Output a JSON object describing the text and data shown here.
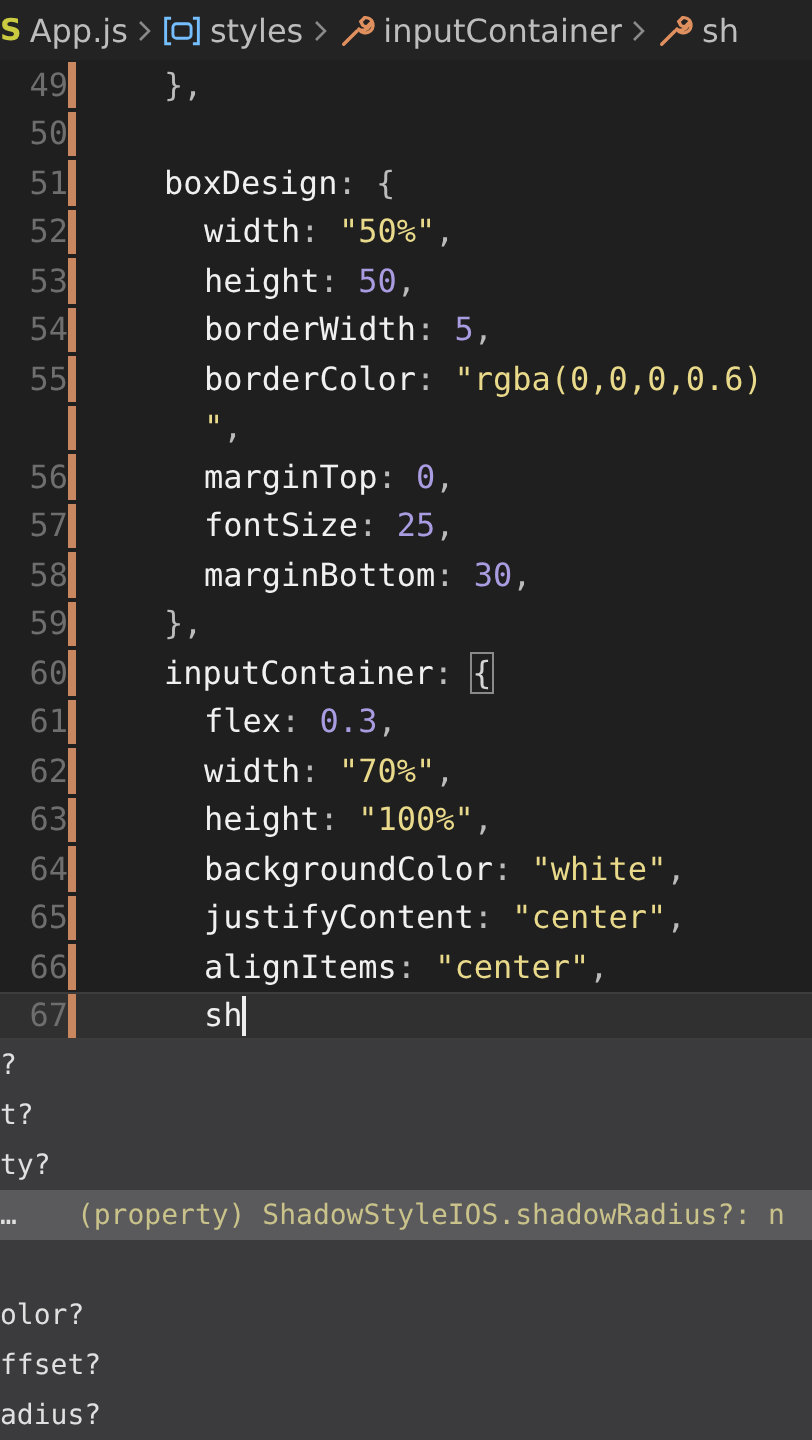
{
  "breadcrumbs": [
    {
      "kind": "file",
      "badge": "S",
      "label": "App.js"
    },
    {
      "kind": "variable",
      "label": "styles"
    },
    {
      "kind": "property",
      "label": "inputContainer"
    },
    {
      "kind": "property",
      "label": "sh"
    }
  ],
  "editor": {
    "lines": [
      {
        "number": "49",
        "tokens": [
          {
            "kind": "punct",
            "text": "},"
          }
        ],
        "current": false,
        "cursor": false
      },
      {
        "number": "50",
        "current": false,
        "cursor": false
      },
      {
        "number": "51",
        "tokens": [
          {
            "kind": "key",
            "text": "boxDesign"
          },
          {
            "kind": "punct",
            "text": ": {"
          }
        ],
        "current": false,
        "cursor": false,
        "children": [
          {
            "number": "52",
            "tokens": [
              {
                "kind": "key",
                "text": "width"
              },
              {
                "kind": "punct",
                "text": ": "
              },
              {
                "kind": "string",
                "text": "\"50%\""
              },
              {
                "kind": "punct",
                "text": ","
              }
            ],
            "current": false,
            "cursor": false
          },
          {
            "number": "53",
            "tokens": [
              {
                "kind": "key",
                "text": "height"
              },
              {
                "kind": "punct",
                "text": ": "
              },
              {
                "kind": "number",
                "text": "50"
              },
              {
                "kind": "punct",
                "text": ","
              }
            ],
            "current": false,
            "cursor": false
          },
          {
            "number": "54",
            "tokens": [
              {
                "kind": "key",
                "text": "borderWidth"
              },
              {
                "kind": "punct",
                "text": ": "
              },
              {
                "kind": "number",
                "text": "5"
              },
              {
                "kind": "punct",
                "text": ","
              }
            ],
            "current": false,
            "cursor": false
          },
          {
            "number": "55",
            "tokens": [
              {
                "kind": "key",
                "text": "borderColor"
              },
              {
                "kind": "punct",
                "text": ": "
              },
              {
                "kind": "string",
                "text": "\"rgba(0,0,0,0.6)"
              }
            ],
            "current": false,
            "cursor": false
          },
          {
            "tokens": [
              {
                "kind": "string",
                "text": "\""
              },
              {
                "kind": "punct",
                "text": ","
              }
            ],
            "current": false,
            "cursor": false
          },
          {
            "number": "56",
            "tokens": [
              {
                "kind": "key",
                "text": "marginTop"
              },
              {
                "kind": "punct",
                "text": ": "
              },
              {
                "kind": "number",
                "text": "0"
              },
              {
                "kind": "punct",
                "text": ","
              }
            ],
            "current": false,
            "cursor": false
          },
          {
            "number": "57",
            "tokens": [
              {
                "kind": "key",
                "text": "fontSize"
              },
              {
                "kind": "punct",
                "text": ": "
              },
              {
                "kind": "number",
                "text": "25"
              },
              {
                "kind": "punct",
                "text": ","
              }
            ],
            "current": false,
            "cursor": false
          },
          {
            "number": "58",
            "tokens": [
              {
                "kind": "key",
                "text": "marginBottom"
              },
              {
                "kind": "punct",
                "text": ": "
              },
              {
                "kind": "number",
                "text": "30"
              },
              {
                "kind": "punct",
                "text": ","
              }
            ],
            "current": false,
            "cursor": false
          }
        ]
      },
      {
        "number": "59",
        "tokens": [
          {
            "kind": "punct",
            "text": "},"
          }
        ],
        "current": false,
        "cursor": false
      },
      {
        "number": "60",
        "tokens": [
          {
            "kind": "key",
            "text": "inputContainer"
          },
          {
            "kind": "punct",
            "text": ": "
          },
          {
            "kind": "bracket",
            "text": "{"
          }
        ],
        "current": false,
        "cursor": false,
        "children": [
          {
            "number": "61",
            "tokens": [
              {
                "kind": "key",
                "text": "flex"
              },
              {
                "kind": "punct",
                "text": ": "
              },
              {
                "kind": "number",
                "text": "0.3"
              },
              {
                "kind": "punct",
                "text": ","
              }
            ],
            "current": false,
            "cursor": false
          },
          {
            "number": "62",
            "tokens": [
              {
                "kind": "key",
                "text": "width"
              },
              {
                "kind": "punct",
                "text": ": "
              },
              {
                "kind": "string",
                "text": "\"70%\""
              },
              {
                "kind": "punct",
                "text": ","
              }
            ],
            "current": false,
            "cursor": false
          },
          {
            "number": "63",
            "tokens": [
              {
                "kind": "key",
                "text": "height"
              },
              {
                "kind": "punct",
                "text": ": "
              },
              {
                "kind": "string",
                "text": "\"100%\""
              },
              {
                "kind": "punct",
                "text": ","
              }
            ],
            "current": false,
            "cursor": false
          },
          {
            "number": "64",
            "tokens": [
              {
                "kind": "key",
                "text": "backgroundColor"
              },
              {
                "kind": "punct",
                "text": ": "
              },
              {
                "kind": "string",
                "text": "\"white\""
              },
              {
                "kind": "punct",
                "text": ","
              }
            ],
            "current": false,
            "cursor": false
          },
          {
            "number": "65",
            "tokens": [
              {
                "kind": "key",
                "text": "justifyContent"
              },
              {
                "kind": "punct",
                "text": ": "
              },
              {
                "kind": "string",
                "text": "\"center\""
              },
              {
                "kind": "punct",
                "text": ","
              }
            ],
            "current": false,
            "cursor": false
          },
          {
            "number": "66",
            "tokens": [
              {
                "kind": "key",
                "text": "alignItems"
              },
              {
                "kind": "punct",
                "text": ": "
              },
              {
                "kind": "string",
                "text": "\"center\""
              },
              {
                "kind": "punct",
                "text": ","
              }
            ],
            "current": false,
            "cursor": false
          },
          {
            "number": "67",
            "tokens": [
              {
                "kind": "key",
                "text": "sh"
              }
            ],
            "current": true,
            "cursor": true
          }
        ]
      }
    ]
  },
  "suggestions": [
    {
      "kind": "item",
      "label": "?",
      "selected": false
    },
    {
      "kind": "item",
      "label": "t?",
      "selected": false
    },
    {
      "kind": "item",
      "label": "ty?",
      "selected": false
    },
    {
      "kind": "item",
      "label": "…",
      "detail": "(property) ShadowStyleIOS.shadowRadius?: n",
      "selected": true
    },
    {
      "kind": "blank",
      "selected": false
    },
    {
      "kind": "item",
      "label": "olor?",
      "selected": false
    },
    {
      "kind": "item",
      "label": "ffset?",
      "selected": false
    },
    {
      "kind": "item",
      "label": "adius?",
      "selected": false
    }
  ]
}
